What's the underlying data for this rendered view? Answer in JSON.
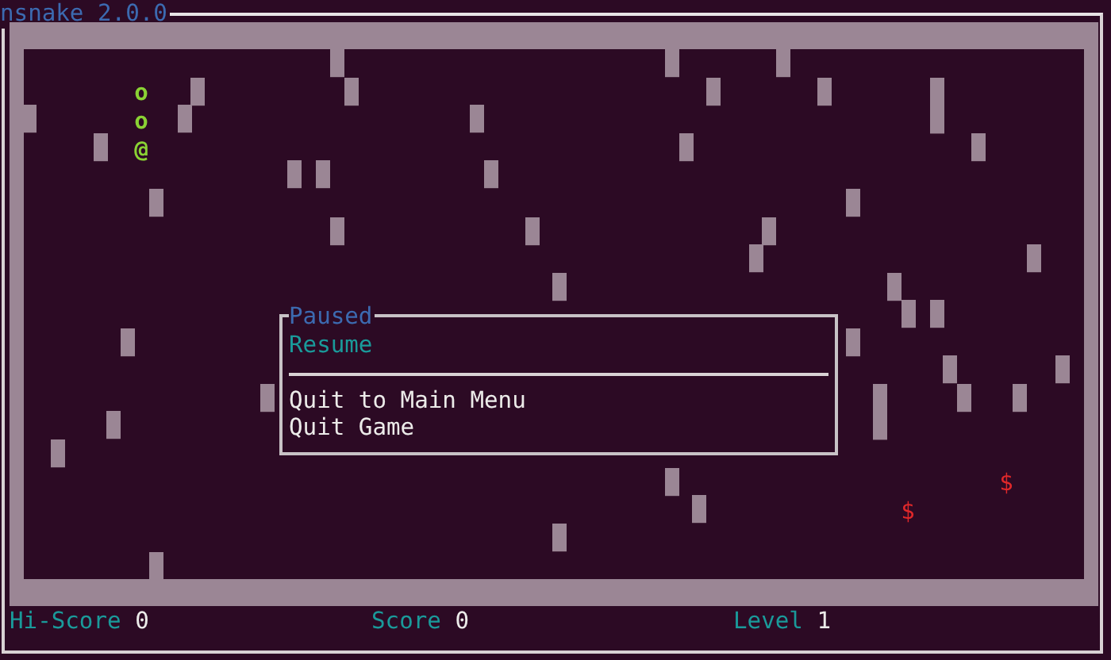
{
  "window": {
    "title": "nsnake 2.0.0"
  },
  "field": {
    "snake": [
      {
        "char": "o"
      },
      {
        "char": "o"
      },
      {
        "char": "@"
      }
    ],
    "food": [
      {
        "char": "$"
      },
      {
        "char": "$"
      }
    ]
  },
  "pause_menu": {
    "title": "Paused",
    "items": [
      {
        "kind": "item",
        "label": "Resume",
        "selected": true
      },
      {
        "kind": "separator"
      },
      {
        "kind": "item",
        "label": "Quit to Main Menu",
        "selected": false
      },
      {
        "kind": "item",
        "label": "Quit Game",
        "selected": false
      }
    ]
  },
  "status_bar": [
    {
      "label": "Hi-Score",
      "value": "0"
    },
    {
      "label": "Score",
      "value": "0"
    },
    {
      "label": "Level",
      "value": "1"
    }
  ]
}
